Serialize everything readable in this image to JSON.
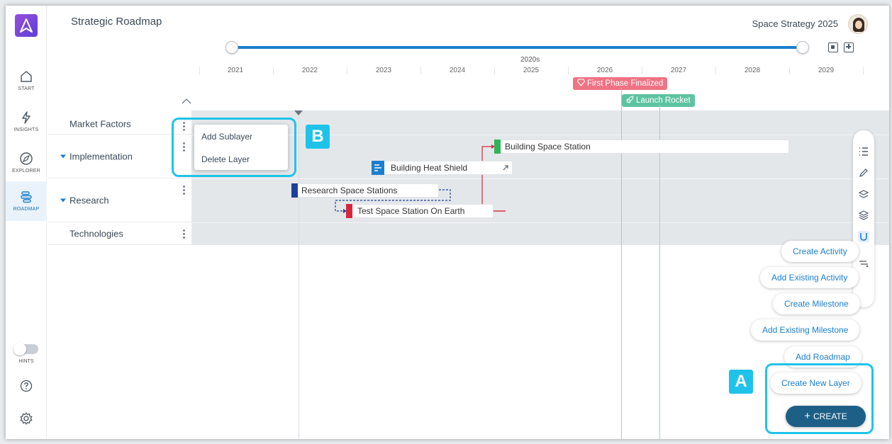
{
  "header": {
    "title": "Strategic Roadmap",
    "project": "Space Strategy 2025"
  },
  "nav": {
    "items": [
      {
        "label": "START",
        "icon": "home-icon"
      },
      {
        "label": "INSIGHTS",
        "icon": "lightning-icon"
      },
      {
        "label": "EXPLORER",
        "icon": "compass-icon"
      },
      {
        "label": "ROADMAP",
        "icon": "roadmap-icon",
        "active": true
      }
    ],
    "hints_label": "HINTS"
  },
  "timeline": {
    "decade": "2020s",
    "years": [
      "2021",
      "2022",
      "2023",
      "2024",
      "2025",
      "2026",
      "2027",
      "2028",
      "2029"
    ]
  },
  "milestones": [
    {
      "label": "First Phase Finalized",
      "icon": "diamond-icon",
      "color": "#ee7384"
    },
    {
      "label": "Launch Rocket",
      "icon": "rocket-icon",
      "color": "#5ec3a1"
    }
  ],
  "layers": [
    {
      "label": "Market Factors",
      "expandable": false
    },
    {
      "label": "Implementation",
      "expandable": true
    },
    {
      "label": "Research",
      "expandable": true
    },
    {
      "label": "Technologies",
      "expandable": false
    }
  ],
  "activities": [
    {
      "label": "Building Space Station",
      "color": "#2fb45a"
    },
    {
      "label": "Building Heat Shield",
      "color": "#1b7fcd"
    },
    {
      "label": "Research Space Stations",
      "color": "#1f3f9a"
    },
    {
      "label": "Test Space Station On Earth",
      "color": "#d6283c"
    }
  ],
  "layer_menu": {
    "items": [
      "Add Sublayer",
      "Delete Layer"
    ]
  },
  "create_menu": {
    "options": [
      "Create Activity",
      "Add Existing Activity",
      "Create Milestone",
      "Add Existing Milestone",
      "Add Roadmap",
      "Create New Layer"
    ],
    "button_label": "CREATE",
    "button_icon": "plus-icon"
  },
  "annotations": {
    "badge_a": "A",
    "badge_b": "B",
    "highlight_color": "#1fc3ea"
  },
  "colors": {
    "accent": "#1b7fcd",
    "create_button": "#1d5f86"
  }
}
